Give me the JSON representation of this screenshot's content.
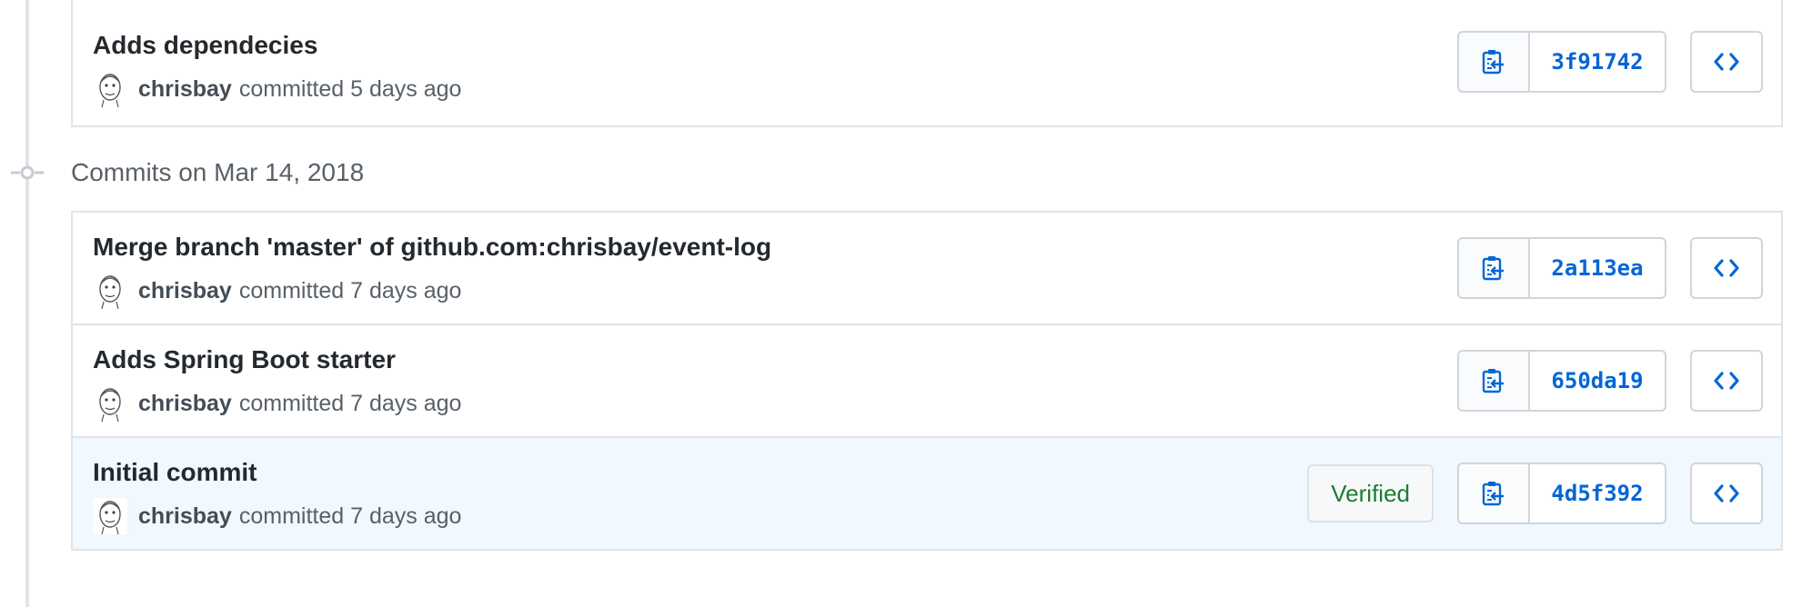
{
  "sections": [
    {
      "header": "",
      "commits": [
        {
          "title": "Adds dependecies",
          "author": "chrisbay",
          "committed_text": "committed 5 days ago",
          "sha": "3f91742",
          "verified": ""
        }
      ]
    },
    {
      "header": "Commits on Mar 14, 2018",
      "commits": [
        {
          "title": "Merge branch 'master' of github.com:chrisbay/event-log",
          "author": "chrisbay",
          "committed_text": "committed 7 days ago",
          "sha": "2a113ea",
          "verified": ""
        },
        {
          "title": "Adds Spring Boot starter",
          "author": "chrisbay",
          "committed_text": "committed 7 days ago",
          "sha": "650da19",
          "verified": ""
        },
        {
          "title": "Initial commit",
          "author": "chrisbay",
          "committed_text": "committed 7 days ago",
          "sha": "4d5f392",
          "verified": "Verified"
        }
      ]
    }
  ],
  "icons": {
    "copy": "clippy-icon",
    "browse": "code-icon",
    "section": "git-commit-icon",
    "avatar": "avatar-sketch"
  },
  "colors": {
    "link": "#0366d6",
    "verified": "#1e7a34",
    "highlight_row": "#f1f8ff",
    "border": "#e1e4e8"
  }
}
